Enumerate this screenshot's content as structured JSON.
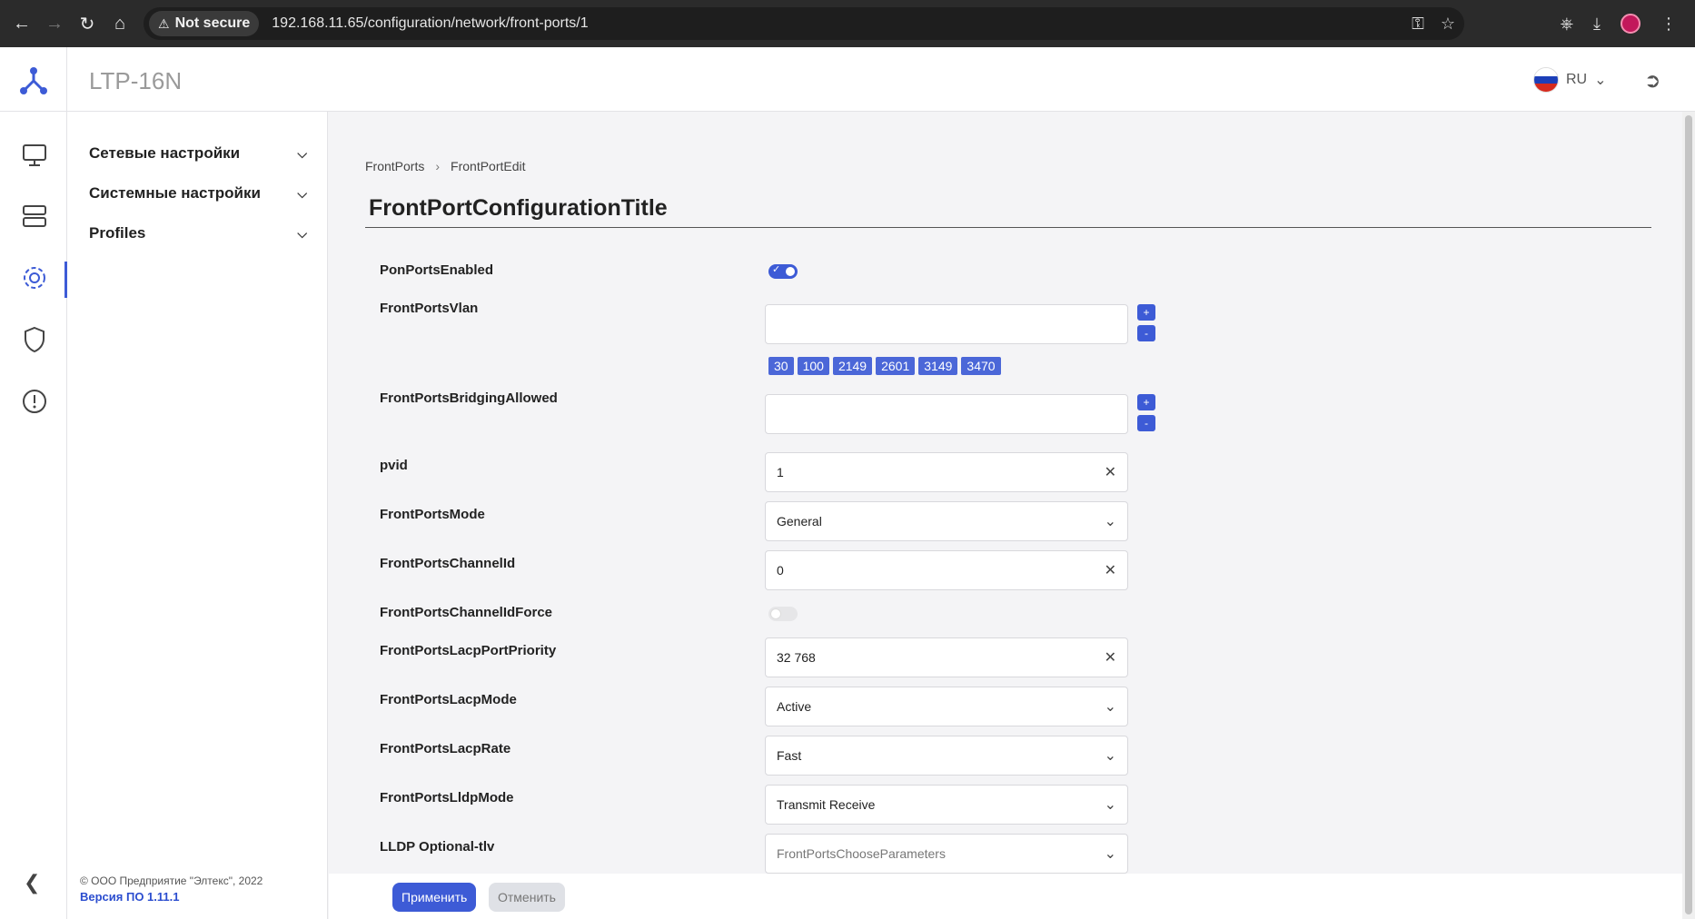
{
  "browser": {
    "secure_label": "Not secure",
    "url": "192.168.11.65/configuration/network/front-ports/1"
  },
  "header": {
    "device_name": "LTP-16N",
    "language": "RU"
  },
  "menu": {
    "items": [
      {
        "label": "Сетевые настройки"
      },
      {
        "label": "Системные настройки"
      },
      {
        "label": "Profiles"
      }
    ],
    "footer_copyright": "© ООО Предприятие \"Элтекс\", 2022",
    "footer_version": "Версия ПО 1.11.1"
  },
  "breadcrumb": {
    "items": [
      "FrontPorts",
      "FrontPortEdit"
    ]
  },
  "page_title": "FrontPortConfigurationTitle",
  "form": {
    "pon_ports_enabled": {
      "label": "PonPortsEnabled",
      "on": true
    },
    "vlan": {
      "label": "FrontPortsVlan",
      "value": "",
      "plus": "+",
      "minus": "-",
      "chips": [
        "30",
        "100",
        "2149",
        "2601",
        "3149",
        "3470"
      ]
    },
    "bridging": {
      "label": "FrontPortsBridgingAllowed",
      "value": "",
      "plus": "+",
      "minus": "-"
    },
    "pvid": {
      "label": "pvid",
      "value": "1"
    },
    "mode": {
      "label": "FrontPortsMode",
      "value": "General"
    },
    "channel_id": {
      "label": "FrontPortsChannelId",
      "value": "0"
    },
    "channel_id_force": {
      "label": "FrontPortsChannelIdForce",
      "on": false
    },
    "lacp_priority": {
      "label": "FrontPortsLacpPortPriority",
      "value": "32 768"
    },
    "lacp_mode": {
      "label": "FrontPortsLacpMode",
      "value": "Active"
    },
    "lacp_rate": {
      "label": "FrontPortsLacpRate",
      "value": "Fast"
    },
    "lldp_mode": {
      "label": "FrontPortsLldpMode",
      "value": "Transmit Receive"
    },
    "lldp_tlv": {
      "label": "LLDP Optional-tlv",
      "placeholder": "FrontPortsChooseParameters"
    }
  },
  "actions": {
    "apply": "Применить",
    "cancel": "Отменить"
  },
  "colors": {
    "accent": "#3d5bd6",
    "chip": "#4b67d8"
  }
}
